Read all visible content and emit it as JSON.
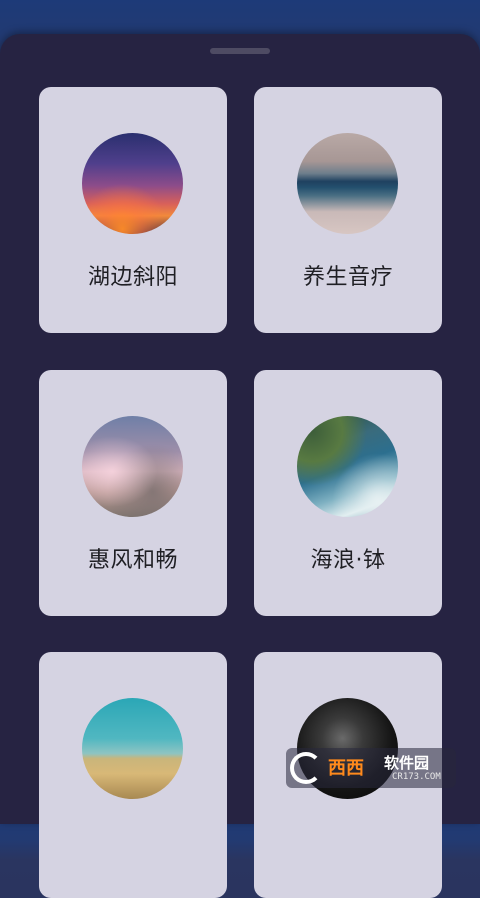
{
  "sheet": {
    "cards": [
      {
        "label": "湖边斜阳",
        "image": "lakeside-sunset-image"
      },
      {
        "label": "养生音疗",
        "image": "calm-sea-image"
      },
      {
        "label": "惠风和畅",
        "image": "soft-clouds-image"
      },
      {
        "label": "海浪·钵",
        "image": "ocean-waves-image"
      },
      {
        "label": "",
        "image": "grass-field-image"
      },
      {
        "label": "",
        "image": "night-sky-image"
      }
    ]
  },
  "watermark": {
    "brand": "西西",
    "site": "软件园",
    "url": "CR173.COM"
  },
  "colors": {
    "sheet_background": "#262342",
    "card_background": "#d5d3e2",
    "label_text": "#1f1f24"
  }
}
